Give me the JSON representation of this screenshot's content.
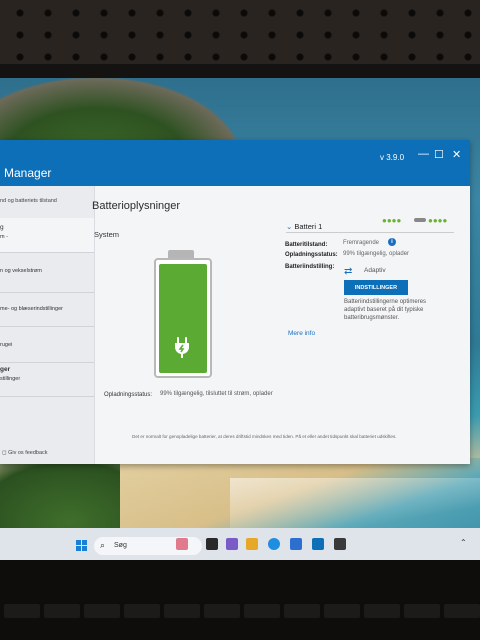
{
  "window": {
    "title": "Manager",
    "version": "v 3.9.0",
    "controls": {
      "minimize": "—",
      "maximize": "☐",
      "close": "✕"
    }
  },
  "sidebar": {
    "header": "nd og batteriets tilstand",
    "items": [
      {
        "line1": "g",
        "line2": "m -"
      },
      {
        "line1": "n og vekselstrøm",
        "line2": ""
      },
      {
        "line1": "me- og blæserindstillinger",
        "line2": ""
      },
      {
        "line1": "rugei",
        "line2": ""
      },
      {
        "line1": "ger",
        "line2": "stillinger"
      }
    ],
    "feedback": "Giv os feedback"
  },
  "main": {
    "title": "Batterioplysninger",
    "system_label": "System",
    "charge_level": 0.99,
    "status_label": "Opladningsstatus:",
    "status_value": "99% tilgængelig, tilsluttet til strøm, oplader"
  },
  "battery": {
    "name": "Batteri 1",
    "dots_left": "●●●●",
    "dots_right": "●●●●",
    "props": [
      {
        "label": "Batteritilstand:",
        "value": "Fremragende"
      },
      {
        "label": "Opladningsstatus:",
        "value": "99% tilgængelig, oplader"
      },
      {
        "label": "Batteriindstilling:",
        "value": "Adaptiv"
      }
    ],
    "settings_button": "INDSTILLINGER",
    "settings_desc": "Batteriindstillingerne optimeres adaptivt baseret på dit typiske batteribrugsmønster.",
    "more_info": "Mere info",
    "footer": "Det er normalt for genopladelige batterier, at deres driftstid mindskes med tiden. På et eller andet tidspunkt skal batteriet udskiftes."
  },
  "taskbar": {
    "search_label": "Søg"
  },
  "colors": {
    "titlebar": "#0c6fb8",
    "battery_fill": "#5aaa33",
    "accent": "#1a6ec0"
  }
}
